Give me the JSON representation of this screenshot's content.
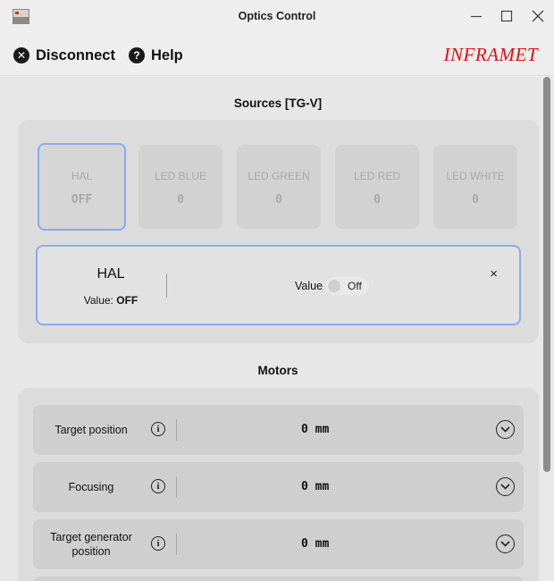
{
  "window": {
    "title": "Optics Control"
  },
  "toolbar": {
    "disconnect_label": "Disconnect",
    "help_label": "Help",
    "brand": "INFRAMET"
  },
  "sources": {
    "title": "Sources [TG-V]",
    "cards": [
      {
        "label": "HAL",
        "value": "OFF",
        "selected": true
      },
      {
        "label": "LED BLUE",
        "value": "0",
        "selected": false
      },
      {
        "label": "LED GREEN",
        "value": "0",
        "selected": false
      },
      {
        "label": "LED RED",
        "value": "0",
        "selected": false
      },
      {
        "label": "LED WHITE",
        "value": "0",
        "selected": false
      }
    ],
    "detail": {
      "name": "HAL",
      "value_prefix": "Value:",
      "value": "OFF",
      "control_label": "Value",
      "toggle_state": "Off",
      "close_glyph": "×"
    }
  },
  "motors": {
    "title": "Motors",
    "rows": [
      {
        "label": "Target position",
        "value": "0 mm"
      },
      {
        "label": "Focusing",
        "value": "0 mm"
      },
      {
        "label": "Target generator position",
        "value": "0 mm"
      }
    ]
  },
  "icons": {
    "app": "camera-icon",
    "disconnect": "close-circle-icon",
    "help": "help-circle-icon",
    "info": "info-icon",
    "expand": "chevron-down-circle-icon"
  },
  "colors": {
    "selection_border": "#8aaaf0",
    "brand": "#e01010"
  }
}
